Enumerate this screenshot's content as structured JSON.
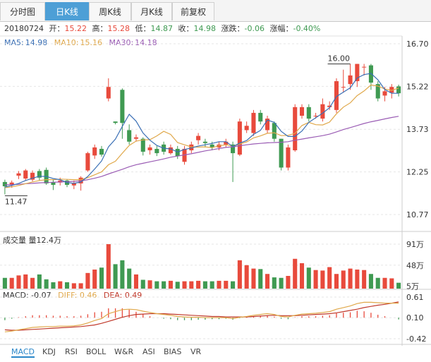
{
  "tabs": [
    "分时图",
    "日K线",
    "周K线",
    "月K线",
    "前复权"
  ],
  "active_tab": 1,
  "info": {
    "date": "20180724",
    "open_label": "开：",
    "open": "15.22",
    "high_label": "高：",
    "high": "15.28",
    "low_label": "低：",
    "low": "14.87",
    "close_label": "收：",
    "close": "14.98",
    "change_label": "涨跌：",
    "change": "-0.06",
    "pct_label": "涨幅：",
    "pct": "-0.40%"
  },
  "ma": {
    "ma5_label": "MA5:",
    "ma5": "14.98",
    "ma10_label": "MA10:",
    "ma10": "15.16",
    "ma30_label": "MA30:",
    "ma30": "14.18"
  },
  "volume_label": "成交量 量12.4万",
  "macd_label": {
    "macd": "MACD: -0.07",
    "diff": "DIFF: 0.46",
    "dea": "DEA: 0.49"
  },
  "indicators": [
    "MACD",
    "KDJ",
    "RSI",
    "BOLL",
    "W&R",
    "ASI",
    "BIAS",
    "VR"
  ],
  "colors": {
    "up": "#e84a3c",
    "down": "#3f9a52",
    "ma5": "#3a6fb5",
    "ma10": "#e0a84a",
    "ma30": "#9a5cb4"
  },
  "chart_data": [
    {
      "type": "candlestick",
      "price_ticks": [
        "16.70",
        "15.22",
        "13.73",
        "12.25",
        "10.77"
      ],
      "ylim": [
        10.77,
        16.7
      ],
      "max_label": "16.00",
      "min_label": "11.47",
      "candles": [
        [
          11.9,
          11.75,
          11.98,
          11.47
        ],
        [
          11.8,
          11.88,
          11.95,
          11.7
        ],
        [
          12.12,
          12.2,
          12.28,
          12.0
        ],
        [
          12.02,
          12.3,
          12.35,
          11.95
        ],
        [
          11.98,
          12.22,
          12.3,
          11.92
        ],
        [
          12.28,
          12.05,
          12.35,
          11.95
        ],
        [
          12.32,
          11.85,
          12.4,
          11.8
        ],
        [
          11.9,
          11.8,
          11.98,
          11.62
        ],
        [
          11.88,
          11.95,
          12.05,
          11.78
        ],
        [
          11.95,
          11.8,
          12.0,
          11.72
        ],
        [
          11.78,
          11.85,
          11.95,
          11.65
        ],
        [
          11.85,
          12.05,
          12.1,
          11.6
        ],
        [
          12.3,
          12.9,
          12.95,
          12.25
        ],
        [
          12.82,
          13.1,
          13.2,
          12.7
        ],
        [
          13.05,
          12.85,
          13.15,
          12.78
        ],
        [
          14.8,
          15.2,
          15.5,
          14.7
        ],
        [
          14.0,
          13.95,
          14.0,
          13.9
        ],
        [
          15.1,
          13.95,
          15.15,
          13.4
        ],
        [
          13.7,
          13.3,
          13.9,
          13.2
        ],
        [
          13.4,
          13.45,
          13.55,
          13.3
        ],
        [
          13.4,
          12.95,
          13.45,
          12.82
        ],
        [
          13.0,
          13.1,
          13.2,
          12.85
        ],
        [
          13.05,
          12.9,
          13.15,
          12.8
        ],
        [
          13.2,
          12.95,
          13.3,
          12.85
        ],
        [
          12.9,
          13.1,
          13.2,
          12.85
        ],
        [
          13.05,
          12.8,
          13.15,
          12.7
        ],
        [
          12.6,
          13.05,
          13.15,
          12.5
        ],
        [
          13.0,
          13.2,
          13.3,
          12.9
        ],
        [
          13.35,
          13.5,
          13.6,
          13.2
        ],
        [
          13.3,
          13.25,
          13.4,
          13.1
        ],
        [
          13.2,
          13.1,
          13.3,
          13.0
        ],
        [
          13.1,
          13.2,
          13.3,
          13.0
        ],
        [
          13.2,
          13.3,
          13.4,
          13.1
        ],
        [
          13.2,
          12.9,
          13.3,
          11.9
        ],
        [
          12.85,
          14.0,
          14.1,
          12.8
        ],
        [
          13.7,
          13.85,
          14.0,
          13.6
        ],
        [
          13.6,
          14.3,
          14.4,
          13.5
        ],
        [
          14.3,
          14.0,
          14.4,
          13.9
        ],
        [
          13.7,
          14.1,
          14.2,
          13.6
        ],
        [
          13.95,
          13.4,
          14.0,
          13.3
        ],
        [
          13.4,
          12.4,
          13.4,
          12.3
        ],
        [
          12.4,
          13.1,
          13.2,
          12.3
        ],
        [
          13.0,
          14.5,
          14.6,
          12.95
        ],
        [
          14.2,
          14.5,
          14.6,
          14.1
        ],
        [
          14.5,
          14.1,
          14.6,
          14.0
        ],
        [
          14.2,
          14.2,
          14.3,
          14.1
        ],
        [
          14.1,
          14.6,
          14.8,
          14.0
        ],
        [
          14.5,
          14.55,
          14.7,
          14.4
        ],
        [
          14.4,
          15.4,
          15.5,
          14.3
        ],
        [
          15.2,
          15.2,
          15.8,
          15.0
        ],
        [
          15.3,
          15.6,
          16.0,
          15.1
        ],
        [
          15.4,
          16.0,
          16.0,
          15.2
        ],
        [
          15.9,
          15.9,
          16.0,
          15.6
        ],
        [
          15.95,
          15.35,
          16.0,
          15.1
        ],
        [
          15.3,
          14.8,
          15.4,
          14.7
        ],
        [
          14.9,
          15.05,
          15.2,
          14.7
        ],
        [
          15.0,
          15.2,
          15.3,
          14.8
        ],
        [
          15.22,
          14.98,
          15.28,
          14.87
        ]
      ],
      "ma5": [
        11.72,
        11.78,
        11.85,
        11.95,
        12.03,
        12.1,
        12.09,
        12.02,
        11.98,
        11.88,
        11.85,
        11.9,
        12.09,
        12.35,
        12.63,
        13.12,
        13.39,
        13.83,
        14.25,
        14.01,
        13.6,
        13.35,
        13.17,
        13.07,
        13.05,
        12.94,
        13.03,
        13.08,
        13.15,
        13.19,
        13.24,
        13.3,
        13.3,
        13.13,
        13.25,
        13.34,
        13.55,
        13.69,
        14.05,
        13.97,
        13.66,
        13.48,
        13.48,
        13.67,
        13.97,
        14.13,
        14.29,
        14.48,
        14.87,
        15.02,
        15.17,
        15.51,
        15.63,
        15.67,
        15.45,
        15.11,
        14.98,
        14.98
      ],
      "ma10": [
        11.7,
        11.73,
        11.78,
        11.84,
        11.9,
        11.95,
        11.98,
        11.98,
        12.0,
        11.99,
        11.98,
        11.98,
        12.05,
        12.15,
        12.25,
        12.5,
        12.62,
        12.9,
        13.17,
        13.32,
        13.36,
        13.37,
        13.5,
        13.66,
        13.55,
        13.27,
        13.19,
        13.12,
        13.11,
        13.12,
        13.09,
        13.16,
        13.19,
        13.14,
        13.22,
        13.29,
        13.43,
        13.5,
        13.59,
        13.61,
        13.51,
        13.52,
        13.59,
        13.86,
        13.97,
        13.89,
        13.88,
        13.98,
        14.27,
        14.5,
        14.65,
        14.9,
        15.06,
        15.27,
        15.23,
        15.13,
        15.08,
        15.16
      ],
      "ma30": [
        11.8,
        11.81,
        11.82,
        11.84,
        11.85,
        11.87,
        11.88,
        11.89,
        11.9,
        11.91,
        11.92,
        11.94,
        11.98,
        12.03,
        12.09,
        12.18,
        12.26,
        12.34,
        12.43,
        12.5,
        12.55,
        12.6,
        12.65,
        12.7,
        12.76,
        12.8,
        12.84,
        12.88,
        12.93,
        12.98,
        13.02,
        13.06,
        13.1,
        13.12,
        13.16,
        13.19,
        13.22,
        13.24,
        13.26,
        13.27,
        13.28,
        13.3,
        13.35,
        13.39,
        13.43,
        13.47,
        13.51,
        13.56,
        13.64,
        13.72,
        13.79,
        13.86,
        13.93,
        13.99,
        14.04,
        14.09,
        14.14,
        14.18
      ]
    },
    {
      "type": "bar",
      "name": "volume",
      "y_ticks": [
        "91万",
        "48万",
        "5万"
      ],
      "ylim": [
        0,
        91
      ],
      "values": [
        22,
        22,
        27,
        29,
        22,
        29,
        19,
        13,
        15,
        13,
        11,
        11,
        32,
        39,
        43,
        91,
        50,
        58,
        41,
        29,
        18,
        17,
        15,
        15,
        16,
        14,
        15,
        15,
        16,
        15,
        15,
        16,
        16,
        15,
        58,
        48,
        41,
        40,
        30,
        23,
        22,
        26,
        61,
        52,
        43,
        38,
        37,
        44,
        30,
        37,
        41,
        39,
        38,
        30,
        22,
        22,
        21,
        12
      ]
    },
    {
      "type": "line",
      "name": "MACD",
      "y_ticks": [
        "0.61",
        "0.10",
        "-0.42"
      ],
      "ylim": [
        -0.42,
        0.61
      ],
      "diff": [
        -0.25,
        -0.23,
        -0.2,
        -0.17,
        -0.14,
        -0.13,
        -0.12,
        -0.12,
        -0.11,
        -0.11,
        -0.1,
        -0.08,
        -0.03,
        0.03,
        0.08,
        0.2,
        0.25,
        0.3,
        0.31,
        0.3,
        0.26,
        0.23,
        0.2,
        0.18,
        0.16,
        0.13,
        0.12,
        0.11,
        0.11,
        0.1,
        0.1,
        0.1,
        0.1,
        0.08,
        0.11,
        0.13,
        0.16,
        0.18,
        0.2,
        0.18,
        0.13,
        0.12,
        0.16,
        0.19,
        0.2,
        0.21,
        0.23,
        0.25,
        0.31,
        0.35,
        0.39,
        0.45,
        0.48,
        0.48,
        0.47,
        0.46,
        0.46,
        0.46
      ],
      "dea": [
        -0.2,
        -0.21,
        -0.21,
        -0.2,
        -0.19,
        -0.18,
        -0.17,
        -0.16,
        -0.15,
        -0.14,
        -0.13,
        -0.12,
        -0.1,
        -0.08,
        -0.04,
        0.01,
        0.06,
        0.11,
        0.15,
        0.18,
        0.19,
        0.2,
        0.2,
        0.2,
        0.19,
        0.18,
        0.17,
        0.16,
        0.15,
        0.14,
        0.13,
        0.13,
        0.12,
        0.12,
        0.12,
        0.12,
        0.13,
        0.14,
        0.15,
        0.16,
        0.15,
        0.15,
        0.15,
        0.16,
        0.17,
        0.18,
        0.19,
        0.2,
        0.22,
        0.25,
        0.28,
        0.31,
        0.35,
        0.38,
        0.41,
        0.43,
        0.46,
        0.49
      ],
      "macd": [
        -0.1,
        -0.04,
        0.02,
        0.06,
        0.1,
        0.1,
        0.1,
        0.08,
        0.08,
        0.06,
        0.06,
        0.08,
        0.14,
        0.22,
        0.24,
        0.38,
        0.38,
        0.38,
        0.32,
        0.24,
        0.14,
        0.06,
        0.0,
        -0.04,
        -0.06,
        -0.1,
        -0.1,
        -0.1,
        -0.08,
        -0.08,
        -0.06,
        -0.06,
        -0.04,
        -0.08,
        -0.02,
        0.02,
        0.06,
        0.08,
        0.1,
        0.04,
        -0.04,
        -0.06,
        0.02,
        0.06,
        0.06,
        0.06,
        0.08,
        0.1,
        0.18,
        0.2,
        0.22,
        0.28,
        0.26,
        0.2,
        0.12,
        0.06,
        0.0,
        -0.07
      ]
    }
  ]
}
